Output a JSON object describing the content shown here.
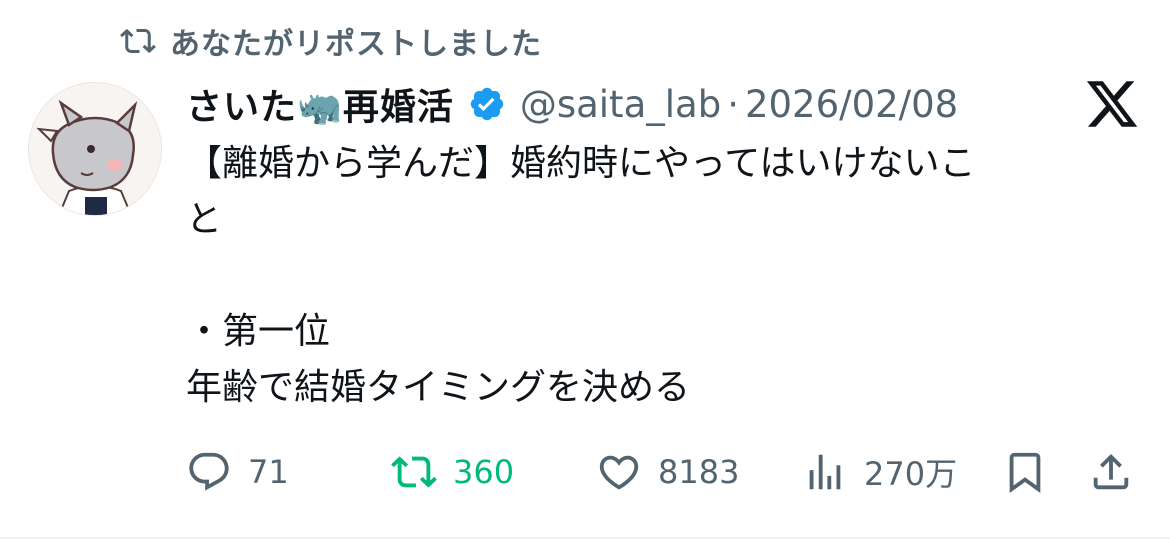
{
  "repost_banner": {
    "icon": "repost-icon",
    "text": "あなたがリポストしました"
  },
  "author": {
    "avatar": "rhino-avatar",
    "display_name": "さいた🦏再婚活",
    "verified": true,
    "verified_color": "#1d9bf0",
    "handle": "@saita_lab",
    "separator": "·",
    "date": "2026/02/08"
  },
  "platform_logo": "x-logo-icon",
  "tweet": {
    "lines": [
      "【離婚から学んだ】婚約時にやってはいけないこ",
      "と",
      "",
      "・第一位",
      "年齢で結婚タイミングを決める"
    ]
  },
  "actions": {
    "reply": {
      "icon": "reply-icon",
      "count": "71"
    },
    "repost": {
      "icon": "repost-icon",
      "count": "360",
      "active": true,
      "color": "#00ba7c"
    },
    "like": {
      "icon": "heart-icon",
      "count": "8183"
    },
    "views": {
      "icon": "views-chart-icon",
      "count": "270万"
    },
    "bookmark": {
      "icon": "bookmark-icon"
    },
    "share": {
      "icon": "share-icon"
    }
  },
  "colors": {
    "text_primary": "#0f1419",
    "text_secondary": "#536471",
    "accent_green": "#00ba7c",
    "verified_blue": "#1d9bf0"
  }
}
